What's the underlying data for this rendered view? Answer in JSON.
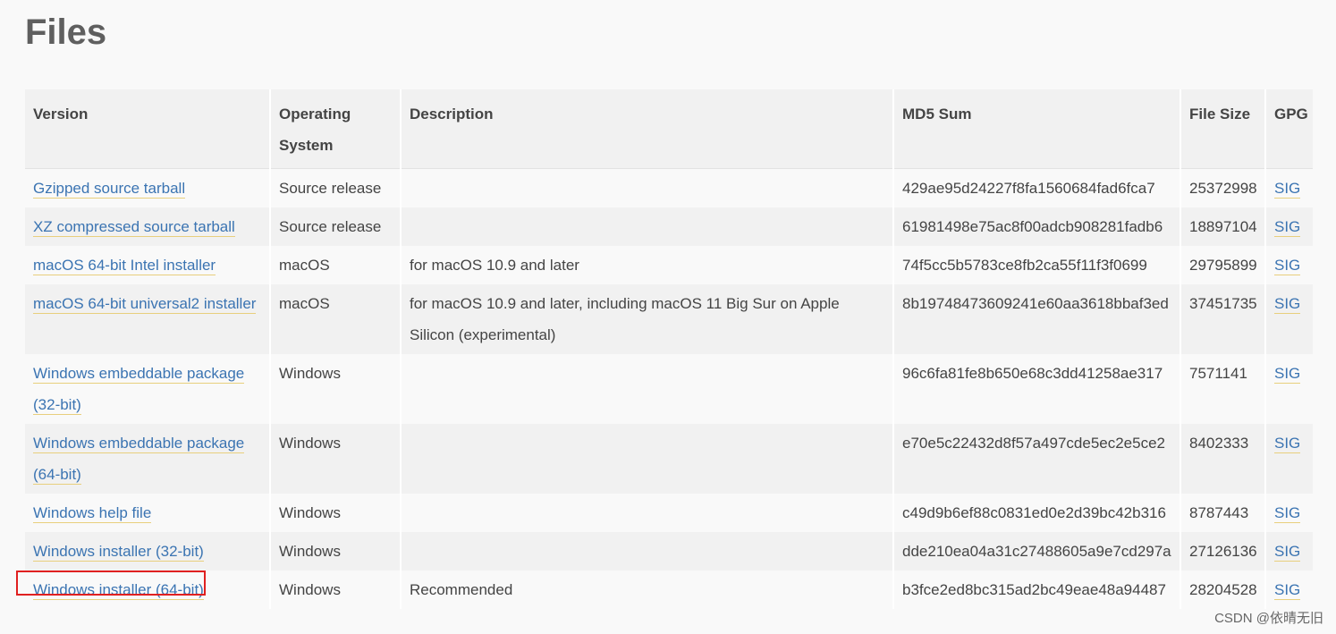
{
  "page": {
    "title": "Files"
  },
  "table": {
    "headers": [
      "Version",
      "Operating System",
      "Description",
      "MD5 Sum",
      "File Size",
      "GPG"
    ],
    "rows": [
      {
        "version": "Gzipped source tarball",
        "os": "Source release",
        "description": "",
        "md5": "429ae95d24227f8fa1560684fad6fca7",
        "size": "25372998",
        "gpg": "SIG"
      },
      {
        "version": "XZ compressed source tarball",
        "os": "Source release",
        "description": "",
        "md5": "61981498e75ac8f00adcb908281fadb6",
        "size": "18897104",
        "gpg": "SIG"
      },
      {
        "version": "macOS 64-bit Intel installer",
        "os": "macOS",
        "description": "for macOS 10.9 and later",
        "md5": "74f5cc5b5783ce8fb2ca55f11f3f0699",
        "size": "29795899",
        "gpg": "SIG"
      },
      {
        "version": "macOS 64-bit universal2 installer",
        "os": "macOS",
        "description": "for macOS 10.9 and later, including macOS 11 Big Sur on Apple Silicon (experimental)",
        "md5": "8b19748473609241e60aa3618bbaf3ed",
        "size": "37451735",
        "gpg": "SIG"
      },
      {
        "version": "Windows embeddable package (32-bit)",
        "os": "Windows",
        "description": "",
        "md5": "96c6fa81fe8b650e68c3dd41258ae317",
        "size": "7571141",
        "gpg": "SIG"
      },
      {
        "version": "Windows embeddable package (64-bit)",
        "os": "Windows",
        "description": "",
        "md5": "e70e5c22432d8f57a497cde5ec2e5ce2",
        "size": "8402333",
        "gpg": "SIG"
      },
      {
        "version": "Windows help file",
        "os": "Windows",
        "description": "",
        "md5": "c49d9b6ef88c0831ed0e2d39bc42b316",
        "size": "8787443",
        "gpg": "SIG"
      },
      {
        "version": "Windows installer (32-bit)",
        "os": "Windows",
        "description": "",
        "md5": "dde210ea04a31c27488605a9e7cd297a",
        "size": "27126136",
        "gpg": "SIG"
      },
      {
        "version": "Windows installer (64-bit)",
        "os": "Windows",
        "description": "Recommended",
        "md5": "b3fce2ed8bc315ad2bc49eae48a94487",
        "size": "28204528",
        "gpg": "SIG"
      }
    ]
  },
  "watermark": "CSDN @依晴无旧",
  "colors": {
    "link": "#3b74b2",
    "link_underline": "#e8cf7d",
    "highlight": "#e02020",
    "header_bg": "#f1f1f1"
  }
}
